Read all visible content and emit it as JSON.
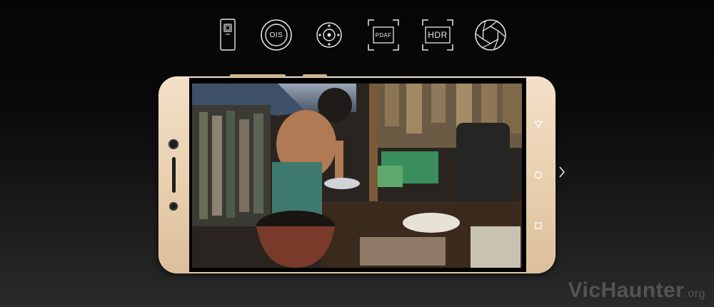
{
  "features": {
    "ois_label": "OIS",
    "pdaf_label": "PDAF",
    "hdr_label": "HDR"
  },
  "watermark": {
    "main": "VicHaunter",
    "suffix": ".org"
  },
  "colors": {
    "phone_body": "#e8cfae",
    "icon_stroke": "#e6e6e6",
    "background_top": "#050505",
    "background_bottom": "#2a2a2a"
  },
  "icons": [
    "phone-outline-icon",
    "ois-icon",
    "focus-ring-icon",
    "pdaf-icon",
    "hdr-icon",
    "aperture-icon",
    "back-triangle-icon",
    "home-circle-icon",
    "recent-square-icon",
    "chevron-right-icon"
  ]
}
